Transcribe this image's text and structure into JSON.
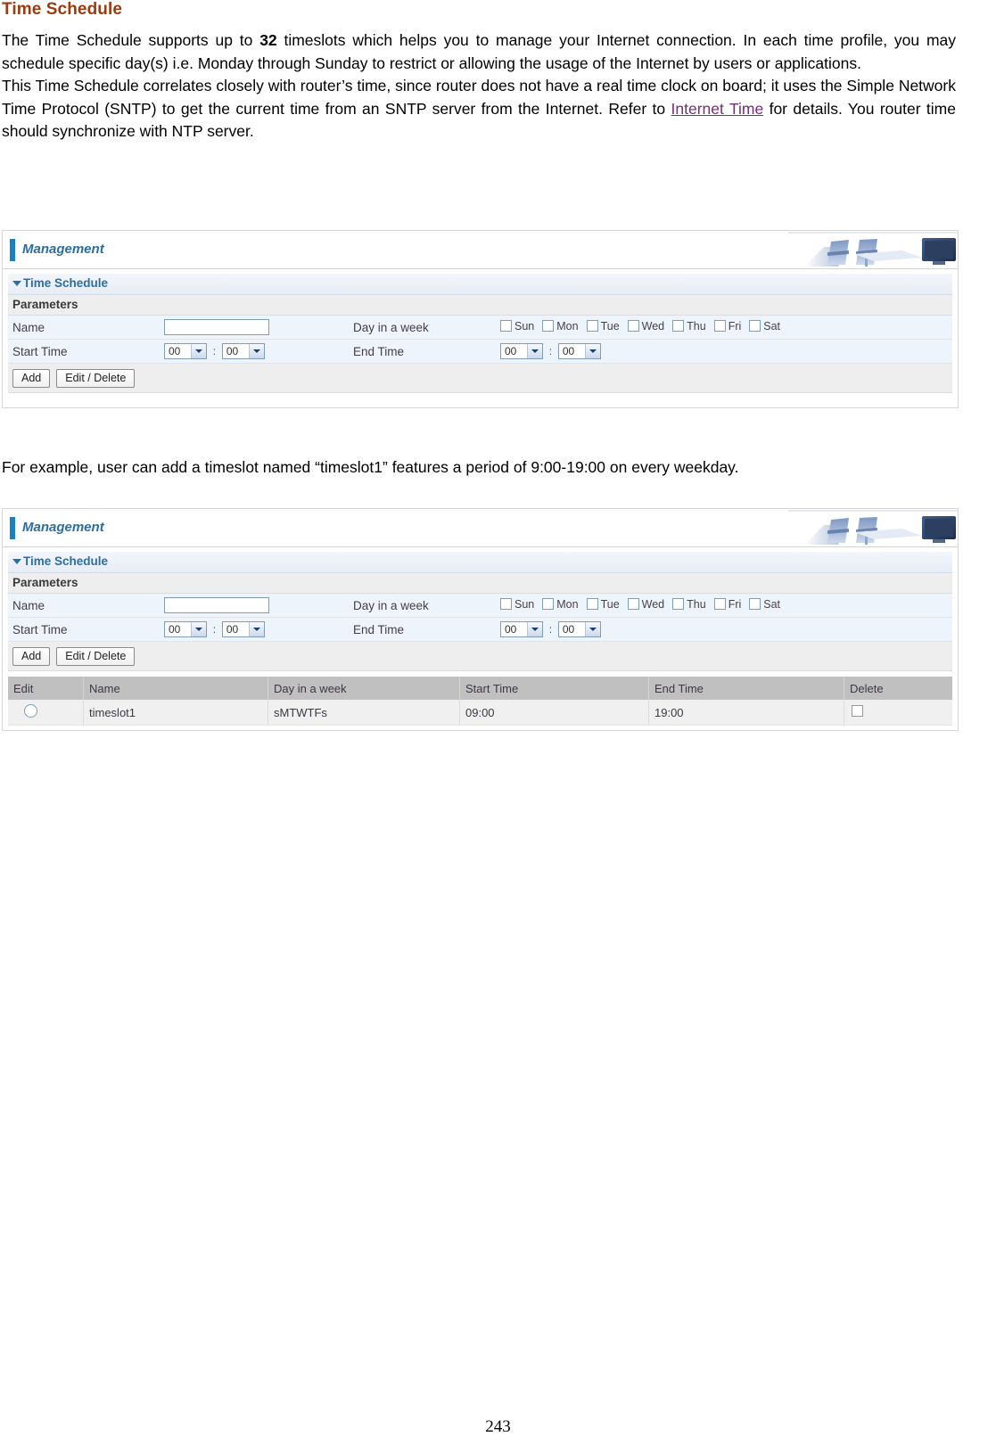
{
  "document": {
    "title": "Time Schedule",
    "paragraph_1": {
      "part_1": "The Time Schedule supports up to ",
      "bold": "32",
      "part_2": " timeslots which helps you to manage your Internet connection. In each time profile, you may schedule specific day(s) i.e. Monday through Sunday to restrict or allowing the usage of the Internet by users or applications."
    },
    "paragraph_2": {
      "part_1": "This Time Schedule correlates closely with router’s time, since router does not have a real time clock on board; it uses the Simple Network Time Protocol (SNTP) to get the current time from an SNTP server from the Internet. Refer to ",
      "link": "Internet Time",
      "part_2": " for details. You router time should synchronize with NTP server."
    },
    "example_text": "For example, user can add a timeslot named “timeslot1” features a period of 9:00-19:00 on every weekday.",
    "page_number": "243"
  },
  "ui": {
    "header_title": "Management",
    "section_title": "Time Schedule",
    "parameters_label": "Parameters",
    "fields": {
      "name_label": "Name",
      "name_value": "",
      "day_in_week_label": "Day in a week",
      "start_time_label": "Start Time",
      "end_time_label": "End Time",
      "start_hour": "00",
      "start_minute": "00",
      "end_hour": "00",
      "end_minute": "00",
      "time_separator": ":"
    },
    "days": [
      {
        "label": "Sun",
        "checked": false
      },
      {
        "label": "Mon",
        "checked": false
      },
      {
        "label": "Tue",
        "checked": false
      },
      {
        "label": "Wed",
        "checked": false
      },
      {
        "label": "Thu",
        "checked": false
      },
      {
        "label": "Fri",
        "checked": false
      },
      {
        "label": "Sat",
        "checked": false
      }
    ],
    "buttons": {
      "add": "Add",
      "edit_delete": "Edit / Delete"
    },
    "list": {
      "headers": [
        "Edit",
        "Name",
        "Day in a week",
        "Start Time",
        "End Time",
        "Delete"
      ],
      "rows": [
        {
          "name": "timeslot1",
          "day_in_week": "sMTWTFs",
          "start_time": "09:00",
          "end_time": "19:00"
        }
      ]
    },
    "colors": {
      "accent_blue": "#1b7fc4",
      "title_blue": "#2a6ea8",
      "heading_brown": "#9b3b12",
      "link_purple": "#7a2a7a",
      "table_header_gray": "#c0c0c0"
    }
  }
}
